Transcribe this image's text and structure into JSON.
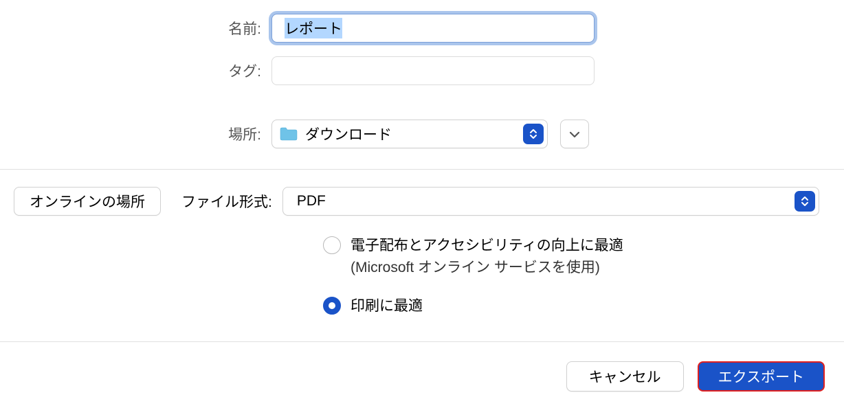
{
  "labels": {
    "name": "名前:",
    "tags": "タグ:",
    "location": "場所:",
    "file_format": "ファイル形式:"
  },
  "fields": {
    "name_value": "レポート",
    "tags_value": "",
    "location_value": "ダウンロード",
    "format_value": "PDF"
  },
  "buttons": {
    "online_location": "オンラインの場所",
    "cancel": "キャンセル",
    "export": "エクスポート"
  },
  "radio": {
    "online_line1": "電子配布とアクセシビリティの向上に最適",
    "online_line2": "(Microsoft オンライン サービスを使用)",
    "print": "印刷に最適",
    "selected": "print"
  }
}
